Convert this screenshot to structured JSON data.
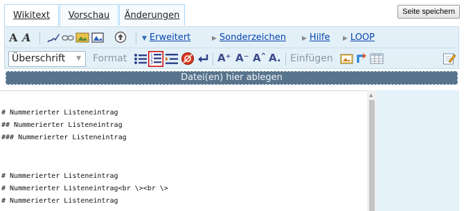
{
  "tabs": {
    "wikitext": "Wikitext",
    "preview": "Vorschau",
    "changes": "Änderungen"
  },
  "save_button": "Seite speichern",
  "toolbar_top": {
    "bold_a": "A",
    "italic_a": "A",
    "advanced": "Erweitert",
    "special_chars": "Sonderzeichen",
    "help": "Hilfe",
    "loop": "LOOP"
  },
  "toolbar_bottom": {
    "heading_select": "Überschrift",
    "format_label": "Format",
    "text_big": "A⁺",
    "text_small": "A⁻",
    "superscript": "Aˆ",
    "subscript": "A.",
    "insert_label": "Einfügen"
  },
  "dropzone": "Datei(en) hier ablegen",
  "editor_lines": [
    "# Nummerierter Listeneintrag",
    "## Nummerierter Listeneintrag",
    "### Nummerierter Listeneintrag",
    "",
    "",
    "# Nummerierter Listeneintrag",
    "# Nummerierter Listeneintrag<br \\><br \\>",
    "# Nummerierter Listeneintrag"
  ],
  "colors": {
    "toolbar_bg": "#e3f0f8",
    "dropzone_bg": "#57748c",
    "link": "#0645ad",
    "tab_border": "#a7d7f9",
    "highlight_border": "#cc0000"
  }
}
